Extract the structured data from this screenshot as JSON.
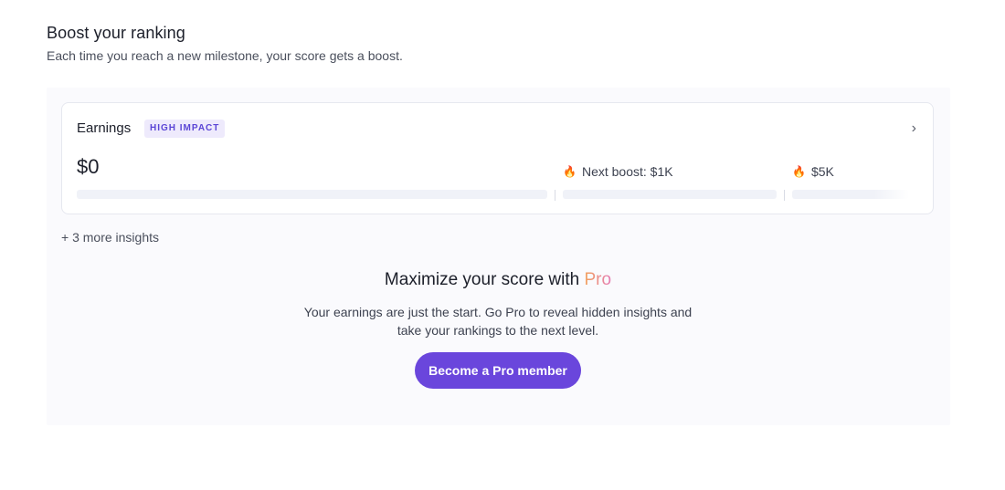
{
  "header": {
    "title": "Boost your ranking",
    "subtitle": "Each time you reach a new milestone, your score gets a boost."
  },
  "card": {
    "title": "Earnings",
    "badge": "HIGH IMPACT",
    "value": "$0",
    "milestones": [
      {
        "label": "Next boost: $1K"
      },
      {
        "label": "$5K"
      }
    ],
    "progress": 0
  },
  "more_insights": "+ 3 more insights",
  "promo": {
    "title_prefix": "Maximize your score with ",
    "title_highlight": "Pro",
    "line1": "Your earnings are just the start. Go Pro to reveal hidden insights and",
    "line2": "take your rankings to the next level.",
    "button_label": "Become a Pro member"
  },
  "colors": {
    "accent": "#6a46dc",
    "badge_bg": "#eeeafc",
    "badge_text": "#5b46d6",
    "flame": "#e5482c"
  },
  "icons": {
    "milestone": "flame-icon",
    "expand": "chevron-right-icon"
  }
}
